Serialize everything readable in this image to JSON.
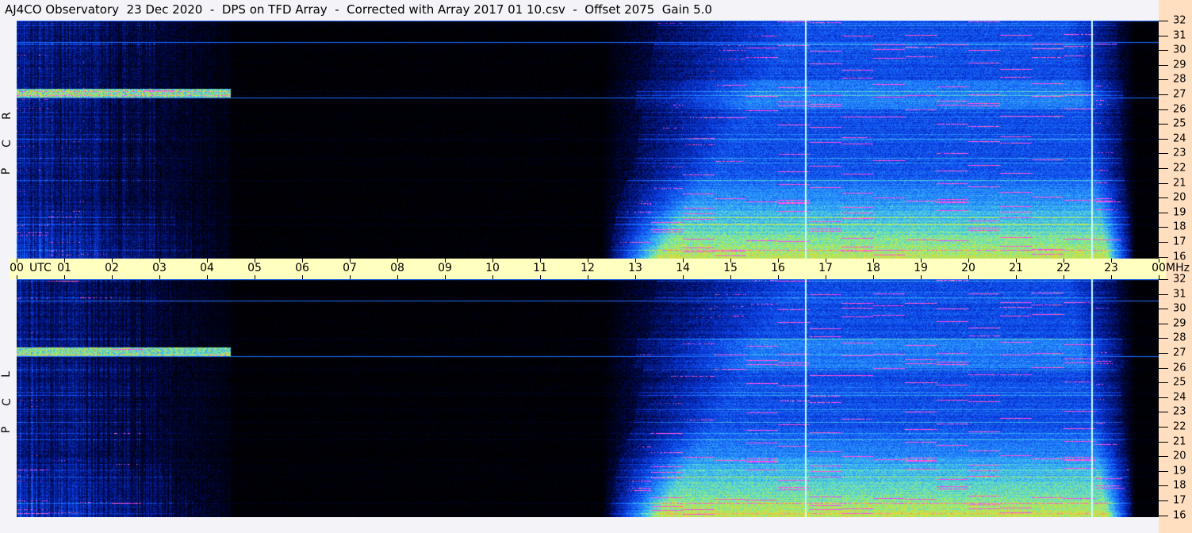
{
  "title": "AJ4CO Observatory  23 Dec 2020  -  DPS on TFD Array  -  Corrected with Array 2017 01 10.csv  -  Offset 2075  Gain 5.0",
  "time_axis": {
    "labels": [
      "00",
      "01",
      "02",
      "03",
      "04",
      "05",
      "06",
      "07",
      "08",
      "09",
      "10",
      "11",
      "12",
      "13",
      "14",
      "15",
      "16",
      "17",
      "18",
      "19",
      "20",
      "21",
      "22",
      "23",
      "00"
    ],
    "utc_label": "UTC",
    "freq_unit": "MHz"
  },
  "freq_axis": {
    "labels": [
      "32",
      "31",
      "30",
      "29",
      "28",
      "27",
      "26",
      "25",
      "24",
      "23",
      "22",
      "21",
      "20",
      "19",
      "18",
      "17",
      "16"
    ]
  },
  "panels": [
    {
      "polarization": [
        "R",
        "C",
        "P"
      ]
    },
    {
      "polarization": [
        "L",
        "C",
        "P"
      ]
    }
  ],
  "colors": {
    "axis_bar": "#ffffc0",
    "freq_axis_bg": "#ffdfc0",
    "background": "#f4f4f8"
  }
}
